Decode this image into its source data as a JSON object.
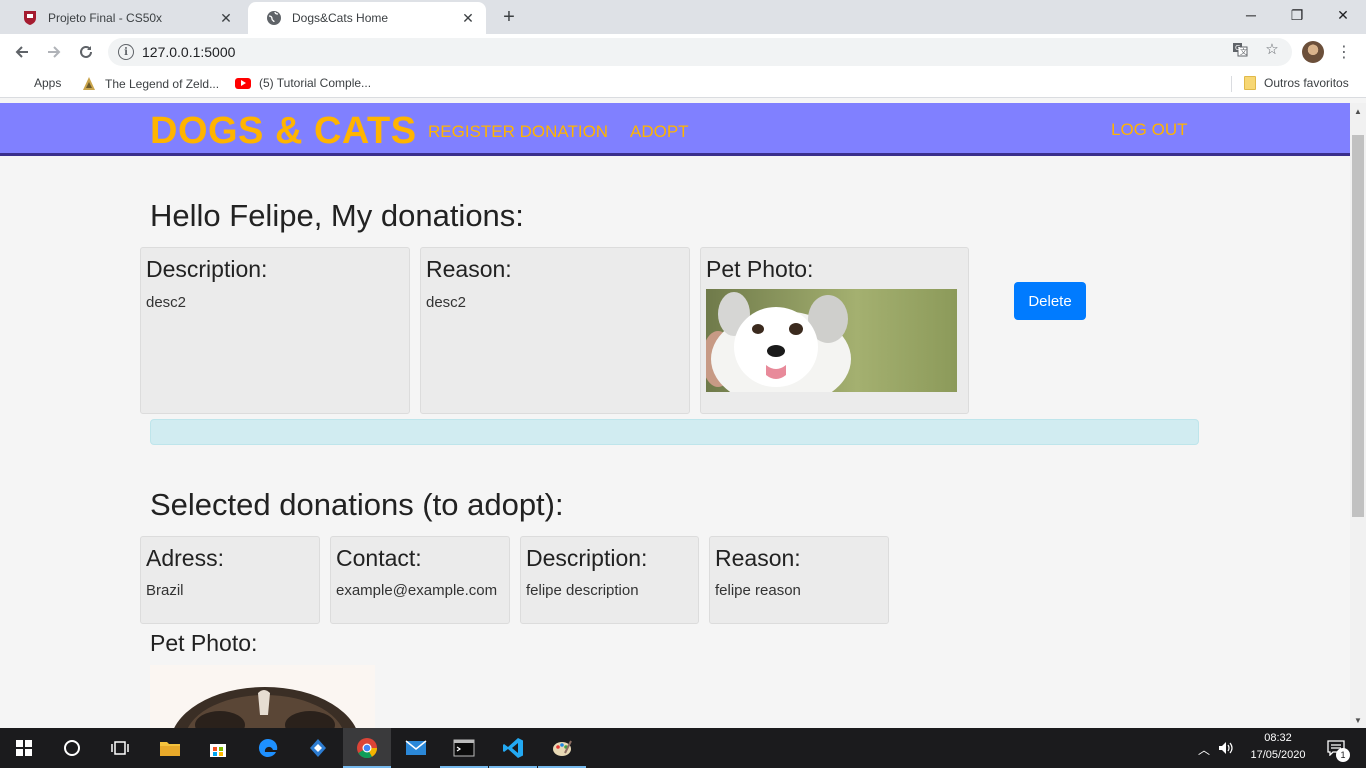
{
  "browser": {
    "tabs": [
      {
        "title": "Projeto Final - CS50x",
        "active": false
      },
      {
        "title": "Dogs&Cats Home",
        "active": true
      }
    ],
    "url": "127.0.0.1:5000",
    "bookmarks": [
      {
        "label": "Apps",
        "icon": "apps-grid-icon"
      },
      {
        "label": "The Legend of Zeld...",
        "icon": "zelda-icon"
      },
      {
        "label": "(5) Tutorial Comple...",
        "icon": "youtube-icon"
      }
    ],
    "other_bookmarks": "Outros favoritos"
  },
  "navbar": {
    "brand": "DOGS & CATS",
    "links": [
      "REGISTER DONATION",
      "ADOPT"
    ],
    "logout": "LOG OUT",
    "bg_color": "#8080ff",
    "accent_color": "#ffb400"
  },
  "my_donations": {
    "heading": "Hello Felipe, My donations:",
    "description_label": "Description:",
    "description_value": "desc2",
    "reason_label": "Reason:",
    "reason_value": "desc2",
    "photo_label": "Pet Photo:",
    "delete_label": "Delete"
  },
  "selected": {
    "heading": "Selected donations (to adopt):",
    "adress_label": "Adress:",
    "adress_value": "Brazil",
    "contact_label": "Contact:",
    "contact_value": "example@example.com",
    "description_label": "Description:",
    "description_value": "felipe description",
    "reason_label": "Reason:",
    "reason_value": "felipe reason",
    "photo_label": "Pet Photo:"
  },
  "taskbar": {
    "time": "08:32",
    "date": "17/05/2020",
    "notification_count": "1"
  }
}
